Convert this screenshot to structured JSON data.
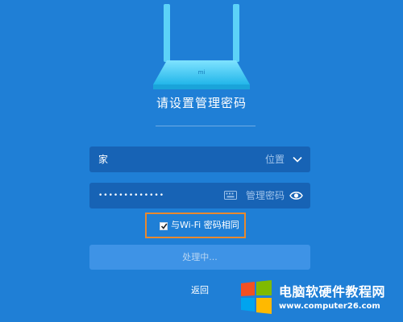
{
  "router_logo_text": "mi",
  "title": "请设置管理密码",
  "network": {
    "value": "家",
    "hint": "位置"
  },
  "password": {
    "masked_value": "•••••••••••••",
    "hint": "管理密码"
  },
  "same_as_wifi": {
    "checked": true,
    "label": "与Wi-Fi 密码相同"
  },
  "submit_label": "处理中...",
  "back_label": "返回",
  "watermark": {
    "title": "电脑软硬件教程网",
    "url": "www.computer26.com"
  },
  "colors": {
    "background": "#1f7fd6",
    "field": "#1763b5",
    "button": "#3e93e6",
    "highlight": "#e8892e"
  }
}
